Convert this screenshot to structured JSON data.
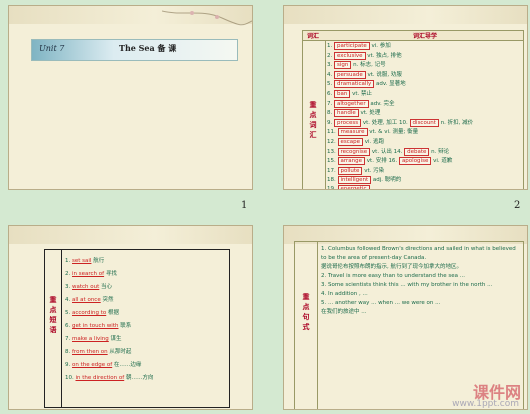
{
  "slide1": {
    "unit": "Unit 7",
    "title": "The Sea 备 课"
  },
  "slide2": {
    "header_left": "词汇",
    "header_right": "词汇导学",
    "side_label": "重点词汇",
    "rows": [
      [
        "1.",
        "participate",
        "vi.",
        "参加"
      ],
      [
        "2.",
        "exclusive",
        "vt.",
        "独占, 排他"
      ],
      [
        "3.",
        "sign",
        "n.",
        "标志, 记号"
      ],
      [
        "4.",
        "persuade",
        "vt.",
        "说服, 劝服"
      ],
      [
        "5.",
        "dramatically",
        "adv.",
        "显著地"
      ],
      [
        "6.",
        "ban",
        "vt.",
        "禁止"
      ],
      [
        "7.",
        "altogether",
        "adv.",
        "完全"
      ],
      [
        "8.",
        "handle",
        "vt.",
        "处理"
      ],
      [
        "9.",
        "process",
        "vt.",
        "处理, 加工",
        "10.",
        "discount",
        "n.",
        "折扣, 减价"
      ],
      [
        "11.",
        "measure",
        "vt. & vi.",
        "测量; 衡量"
      ],
      [
        "12.",
        "escape",
        "vi.",
        "逃跑"
      ],
      [
        "13.",
        "recognise",
        "vt.",
        "认出",
        "14.",
        "debate",
        "n.",
        "辩论"
      ],
      [
        "15.",
        "arrange",
        "vt.",
        "安排",
        "16.",
        "apologise",
        "vi.",
        "道歉"
      ],
      [
        "17.",
        "pollute",
        "vt.",
        "污染"
      ],
      [
        "18.",
        "intelligent",
        "adj.",
        "聪明的"
      ],
      [
        "19.",
        "energetic",
        "",
        ""
      ]
    ]
  },
  "slide3": {
    "side_label": "重点短语",
    "rows": [
      [
        "1.",
        "set sail",
        "",
        "航行"
      ],
      [
        "2.",
        "in search of",
        "",
        "寻找"
      ],
      [
        "3.",
        "watch out",
        "",
        "当心"
      ],
      [
        "4.",
        "all at once",
        "",
        "突然"
      ],
      [
        "5.",
        "according to",
        "",
        "根据"
      ],
      [
        "6.",
        "get in touch with",
        "",
        "联系"
      ],
      [
        "7.",
        "make a living",
        "",
        "谋生"
      ],
      [
        "8.",
        "from then on",
        "",
        "从那时起"
      ],
      [
        "9.",
        "on the edge of",
        "",
        "在……边缘"
      ],
      [
        "10.",
        "in the direction of",
        "",
        "朝……方向"
      ]
    ]
  },
  "slide4": {
    "side_label": "重点句式",
    "paragraphs": [
      "1. Columbus followed Brown's directions and sailed in  what  is believed to be the area of present-day Canada.",
      "据说哥伦布按照布朗的指示, 航行到了现今加拿大的地区。",
      "2. Travel is  more  easy than to  understand  the sea ...",
      "3. Some scientists think this ...  with  my brother  in  the north ...",
      "4.  In addition , ...",
      "5. ... another way ...  when  ... we were on ...",
      "在我们的旅途中 ..."
    ],
    "watermark": "课件网",
    "watermark_url": "www.1ppt.com"
  },
  "page_numbers": {
    "p1": "1",
    "p2": "2"
  }
}
